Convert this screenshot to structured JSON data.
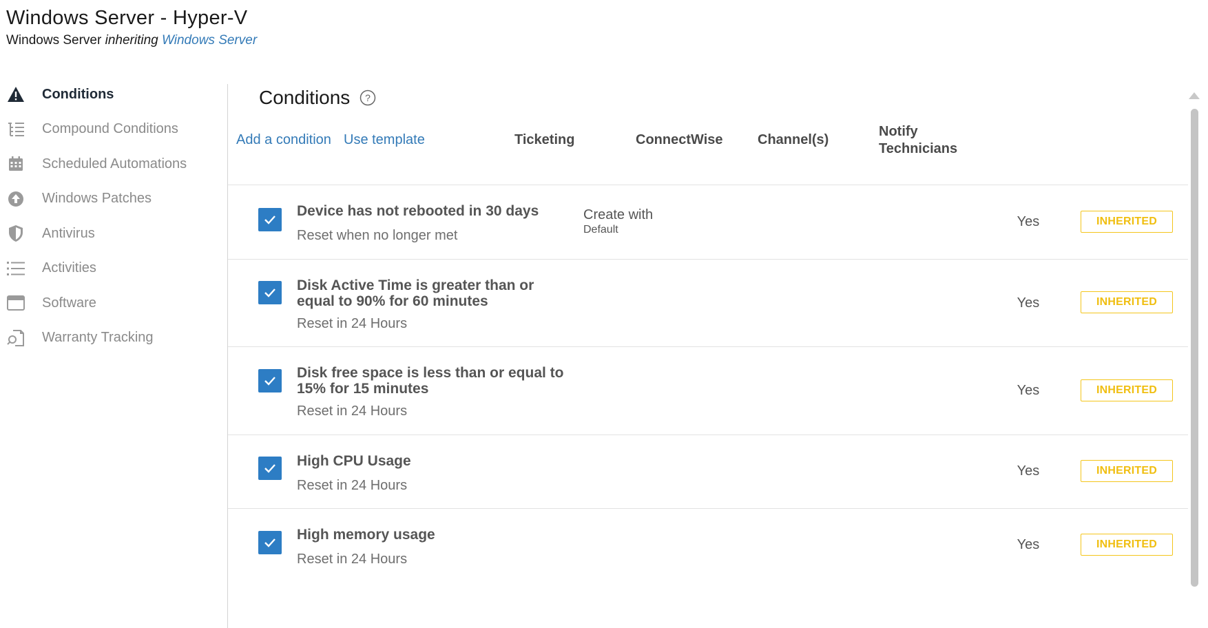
{
  "header": {
    "title": "Windows Server - Hyper-V",
    "subtitle_prefix": "Windows Server",
    "subtitle_inheriting": "inheriting",
    "subtitle_link": "Windows Server"
  },
  "sidebar": {
    "items": [
      {
        "label": "Conditions",
        "icon": "warning-icon",
        "active": true
      },
      {
        "label": "Compound Conditions",
        "icon": "tree-list-icon",
        "active": false
      },
      {
        "label": "Scheduled Automations",
        "icon": "calendar-icon",
        "active": false
      },
      {
        "label": "Windows Patches",
        "icon": "arrow-up-circle-icon",
        "active": false
      },
      {
        "label": "Antivirus",
        "icon": "shield-icon",
        "active": false
      },
      {
        "label": "Activities",
        "icon": "list-icon",
        "active": false
      },
      {
        "label": "Software",
        "icon": "window-icon",
        "active": false
      },
      {
        "label": "Warranty Tracking",
        "icon": "document-search-icon",
        "active": false
      }
    ]
  },
  "main": {
    "title": "Conditions",
    "add_condition": "Add a condition",
    "use_template": "Use template",
    "columns": {
      "ticketing": "Ticketing",
      "connectwise": "ConnectWise",
      "channels": "Channel(s)",
      "notify_line1": "Notify",
      "notify_line2": "Technicians"
    },
    "rows": [
      {
        "name": "Device has not rebooted in 30 days",
        "reset": "Reset when no longer met",
        "ticketing": "Create with",
        "ticketing_sub": "Default",
        "notify": "Yes",
        "badge": "INHERITED",
        "checked": true
      },
      {
        "name": "Disk Active Time is greater than or equal to 90% for 60 minutes",
        "reset": "Reset in 24 Hours",
        "ticketing": "",
        "ticketing_sub": "",
        "notify": "Yes",
        "badge": "INHERITED",
        "checked": true
      },
      {
        "name": "Disk free space is less than or equal to 15% for 15 minutes",
        "reset": "Reset in 24 Hours",
        "ticketing": "",
        "ticketing_sub": "",
        "notify": "Yes",
        "badge": "INHERITED",
        "checked": true
      },
      {
        "name": "High CPU Usage",
        "reset": "Reset in 24 Hours",
        "ticketing": "",
        "ticketing_sub": "",
        "notify": "Yes",
        "badge": "INHERITED",
        "checked": true
      },
      {
        "name": "High memory usage",
        "reset": "Reset in 24 Hours",
        "ticketing": "",
        "ticketing_sub": "",
        "notify": "Yes",
        "badge": "INHERITED",
        "checked": true
      }
    ]
  },
  "colors": {
    "accent": "#2d7dc4",
    "link": "#337ab7",
    "badge": "#f4c51a"
  }
}
